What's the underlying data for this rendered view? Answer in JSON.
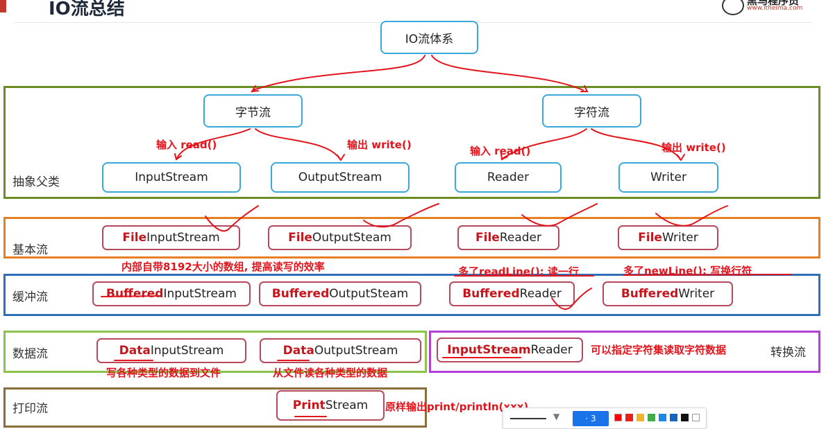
{
  "header": {
    "title": "IO流总结",
    "logo_text": "黑马程序员",
    "logo_url": "www.itheima.com"
  },
  "root": "IO流体系",
  "abstract": {
    "label": "抽象父类",
    "byte_stream": "字节流",
    "char_stream": "字符流",
    "input_stream": "InputStream",
    "output_stream": "OutputStream",
    "reader": "Reader",
    "writer": "Writer"
  },
  "basic": {
    "label": "基本流",
    "items": [
      {
        "prefix": "File",
        "suffix": "InputStream"
      },
      {
        "prefix": "File",
        "suffix": "OutputSteam"
      },
      {
        "prefix": "File",
        "suffix": "Reader"
      },
      {
        "prefix": "File",
        "suffix": "Writer"
      }
    ]
  },
  "buffered": {
    "label": "缓冲流",
    "items": [
      {
        "prefix": "Buffered",
        "suffix": "InputStream"
      },
      {
        "prefix": "Buffered",
        "suffix": "OutputSteam"
      },
      {
        "prefix": "Buffered",
        "suffix": "Reader"
      },
      {
        "prefix": "Buffered",
        "suffix": "Writer"
      }
    ]
  },
  "data": {
    "label": "数据流",
    "items": [
      {
        "prefix": "Data",
        "suffix": "InputStream"
      },
      {
        "prefix": "Data",
        "suffix": "OutputStream"
      }
    ]
  },
  "convert": {
    "label": "转换流",
    "prefix": "InputStream",
    "suffix": "Reader"
  },
  "print": {
    "label": "打印流",
    "prefix": "Print",
    "suffix": "Stream"
  },
  "annotations": {
    "input_read_1": "输入 read()",
    "output_write_1": "输出  write()",
    "input_read_2": "输入 read()",
    "output_write_2": "输出 write()",
    "buffer_note": "内部自带8192大小的数组, 提高读写的效率",
    "readline_note": "多了readLine(); 读一行",
    "newline_note": "多了newLine(); 写换行符",
    "data_write_note": "写各种类型的数据到文件",
    "data_read_note": "从文件读各种类型的数据",
    "charset_note": "可以指定字符集读取字符数据",
    "print_note": "原样输出print/println(xxx)"
  },
  "toolbar": {
    "stroke_size": "3",
    "swatch_colors": [
      "#ff0000",
      "#e6201b",
      "#f0b429",
      "#3cb043",
      "#1e88e5",
      "#1565c0",
      "#111111",
      "#ffffff"
    ]
  },
  "colors": {
    "section_abstract": "#6b8e23",
    "section_basic": "#e67e22",
    "section_buffered": "#2f6fb5",
    "section_data": "#8bc34a",
    "section_convert": "#b23fd6",
    "section_print": "#8a6d3b",
    "annotation": "#e2141c"
  }
}
